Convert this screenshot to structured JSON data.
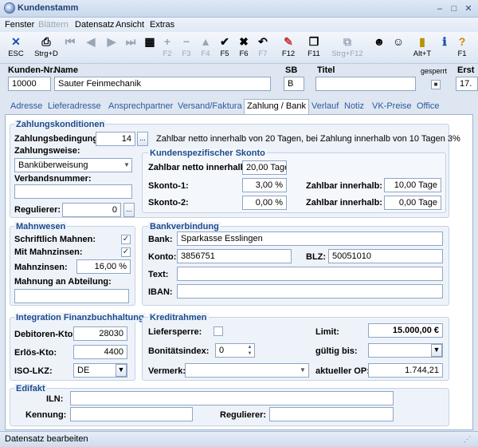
{
  "window": {
    "title": "Kundenstamm"
  },
  "menu": [
    "Fenster",
    "Blättern",
    "Datensatz",
    "Ansicht",
    "Extras"
  ],
  "toolbar": {
    "esc": "ESC",
    "strg_d": "Strg+D",
    "f2": "F2",
    "f3": "F3",
    "f4": "F4",
    "f5": "F5",
    "f6": "F6",
    "f7": "F7",
    "f12": "F12",
    "f11": "F11",
    "strg_f12": "Strg+F12",
    "alt_t": "Alt+T",
    "f1": "F1"
  },
  "header": {
    "kundennr_label": "Kunden-Nr.",
    "name_label": "Name",
    "sb_label": "SB",
    "titel_label": "Titel",
    "gesperrt_label": "gesperrt",
    "erst_label": "Erst",
    "kundennr": "10000",
    "name": "Sauter Feinmechanik",
    "sb": "B",
    "titel": "",
    "erst": "17."
  },
  "tabs": [
    "Adresse",
    "Lieferadresse",
    "Ansprechpartner",
    "Versand/Faktura",
    "Zahlung / Bank",
    "Verlauf",
    "Notiz",
    "VK-Preise",
    "Office"
  ],
  "zahlung": {
    "title": "Zahlungskonditionen",
    "bedingung_label": "Zahlungsbedingung:",
    "bedingung": "14",
    "bedingung_text": "Zahlbar netto innerhalb von 20 Tagen, bei Zahlung innerhalb von 10 Tagen 3%",
    "weise_label": "Zahlungsweise:",
    "weise": "Banküberweisung",
    "verband_label": "Verbandsnummer:",
    "verband": "",
    "regulierer_label": "Regulierer:",
    "regulierer": "0"
  },
  "skonto": {
    "title": "Kundenspezifischer Skonto",
    "netto_label": "Zahlbar netto innerhalb:",
    "netto": "20,00 Tage",
    "s1_label": "Skonto-1:",
    "s1": "3,00 %",
    "z1_label": "Zahlbar innerhalb:",
    "z1": "10,00 Tage",
    "s2_label": "Skonto-2:",
    "s2": "0,00 %",
    "z2_label": "Zahlbar innerhalb:",
    "z2": "0,00 Tage"
  },
  "mahn": {
    "title": "Mahnwesen",
    "schriftlich_label": "Schriftlich Mahnen:",
    "zinsen_label": "Mit Mahnzinsen:",
    "mahnzinsen_label": "Mahnzinsen:",
    "mahnzinsen": "16,00 %",
    "abteilung_label": "Mahnung an Abteilung:",
    "abteilung": ""
  },
  "bank": {
    "title": "Bankverbindung",
    "bank_label": "Bank:",
    "bank": "Sparkasse Esslingen",
    "konto_label": "Konto:",
    "konto": "3856751",
    "blz_label": "BLZ:",
    "blz": "50051010",
    "text_label": "Text:",
    "text": "",
    "iban_label": "IBAN:",
    "iban": ""
  },
  "fibu": {
    "title": "Integration Finanzbuchhaltung",
    "debitoren_label": "Debitoren-Kto:",
    "debitoren": "28030",
    "erloes_label": "Erlös-Kto:",
    "erloes": "4400",
    "iso_label": "ISO-LKZ:",
    "iso": "DE"
  },
  "kredit": {
    "title": "Kreditrahmen",
    "liefersperre_label": "Liefersperre:",
    "limit_label": "Limit:",
    "limit": "15.000,00 €",
    "bonitaet_label": "Bonitätsindex:",
    "bonitaet": "0",
    "gueltig_label": "gültig bis:",
    "gueltig": "",
    "vermerk_label": "Vermerk:",
    "vermerk": "",
    "op_label": "aktueller OP:",
    "op": "1.744,21"
  },
  "edifakt": {
    "title": "Edifakt",
    "iln_label": "ILN:",
    "iln": "",
    "kennung_label": "Kennung:",
    "kennung": "",
    "regulierer_label": "Regulierer:",
    "regulierer": ""
  },
  "status": {
    "text": "Datensatz bearbeiten"
  }
}
